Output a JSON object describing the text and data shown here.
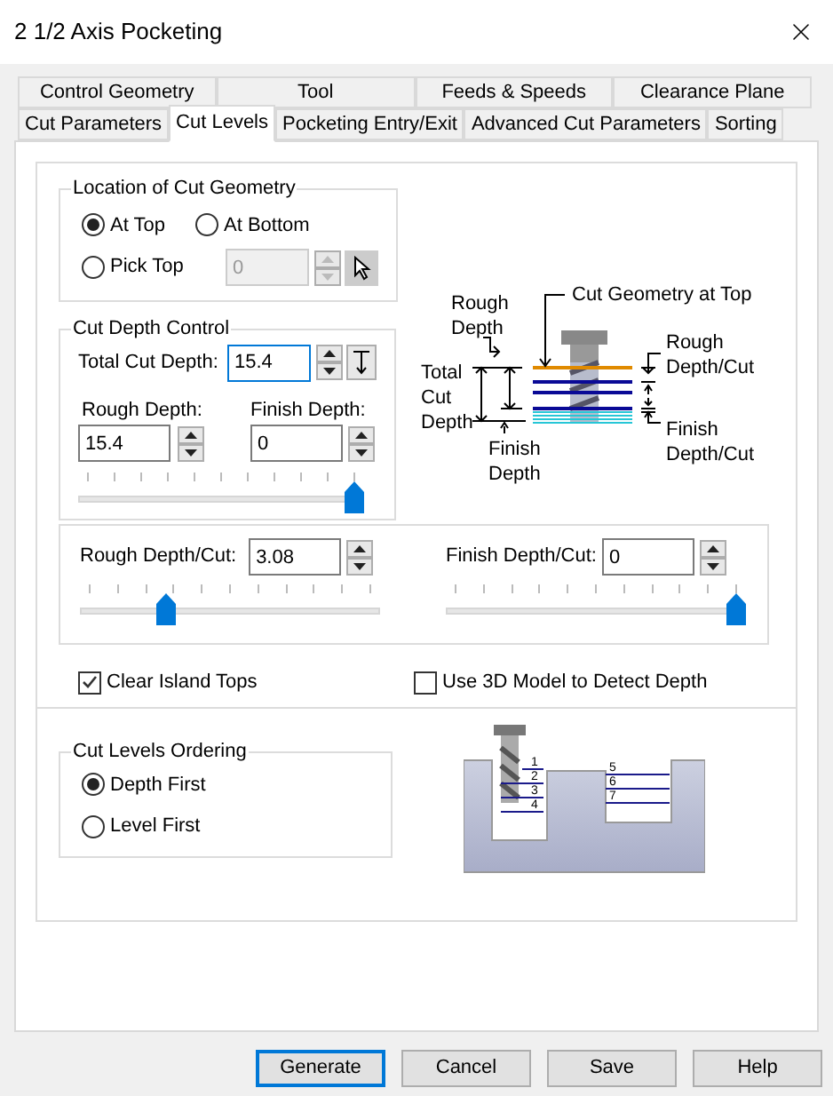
{
  "window": {
    "title": "2 1/2 Axis Pocketing"
  },
  "tabs": [
    [
      {
        "label": "Control Geometry",
        "selected": false
      },
      {
        "label": "Tool",
        "selected": false
      },
      {
        "label": "Feeds & Speeds",
        "selected": false
      },
      {
        "label": "Clearance Plane",
        "selected": false
      }
    ],
    [
      {
        "label": "Cut Parameters",
        "selected": false
      },
      {
        "label": "Cut Levels",
        "selected": true
      },
      {
        "label": "Pocketing Entry/Exit",
        "selected": false
      },
      {
        "label": "Advanced Cut Parameters",
        "selected": false
      },
      {
        "label": "Sorting",
        "selected": false
      }
    ]
  ],
  "location": {
    "title": "Location of Cut Geometry",
    "options": [
      {
        "label": "At Top",
        "selected": true
      },
      {
        "label": "At Bottom",
        "selected": false
      },
      {
        "label": "Pick Top",
        "selected": false
      }
    ],
    "pick_top_value": "0",
    "pick_top_disabled": true
  },
  "cut_depth": {
    "title": "Cut Depth Control",
    "total_label": "Total Cut Depth:",
    "total_value": "15.4",
    "rough_label": "Rough Depth:",
    "rough_value": "15.4",
    "finish_label": "Finish Depth:",
    "finish_value": "0",
    "level": 1
  },
  "depth_diagram": {
    "labels": [
      "Rough Depth",
      "Cut Geometry at Top",
      "Total Cut Depth",
      "Finish Depth",
      "Rough Depth/Cut",
      "Finish Depth/Cut"
    ]
  },
  "per_cut": [
    {
      "label": "Rough Depth/Cut:",
      "value": "3.08",
      "level": 0.27
    },
    {
      "label": "Finish Depth/Cut:",
      "value": "0",
      "level": 1
    }
  ],
  "checkboxes": [
    {
      "label": "Clear Island Tops",
      "checked": true
    },
    {
      "label": "Use 3D Model to Detect Depth",
      "checked": false
    }
  ],
  "ordering": {
    "title": "Cut Levels Ordering",
    "options": [
      {
        "label": "Depth First",
        "selected": true
      },
      {
        "label": "Level First",
        "selected": false
      }
    ]
  },
  "ordering_diagram": {
    "numbers": [
      "1",
      "2",
      "3",
      "4",
      "5",
      "6",
      "7"
    ]
  },
  "buttons": [
    {
      "label": "Generate",
      "default": true
    },
    {
      "label": "Cancel",
      "default": false
    },
    {
      "label": "Save",
      "default": false
    },
    {
      "label": "Help",
      "default": false
    }
  ]
}
